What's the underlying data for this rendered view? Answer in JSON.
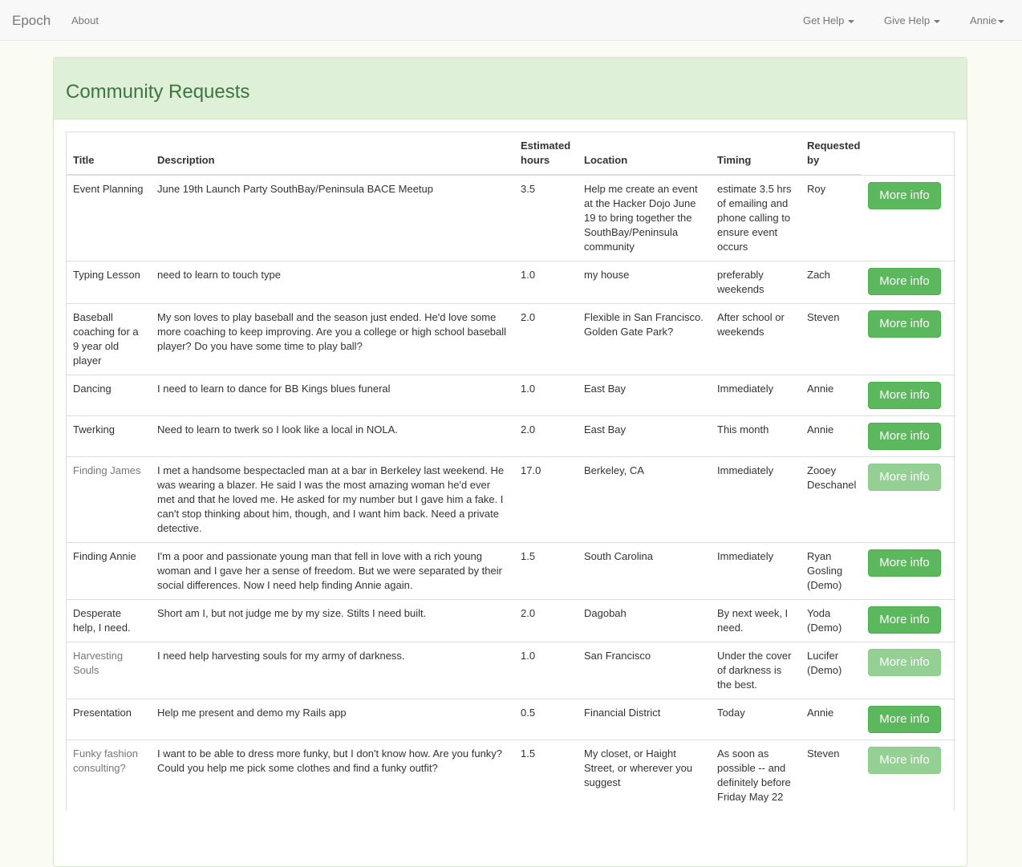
{
  "navbar": {
    "brand": "Epoch",
    "about": "About",
    "get_help": "Get Help",
    "give_help": "Give Help",
    "user": "Annie"
  },
  "panel": {
    "title": "Community Requests"
  },
  "table": {
    "headers": {
      "title": "Title",
      "description": "Description",
      "hours": "Estimated hours",
      "location": "Location",
      "timing": "Timing",
      "requested_by": "Requested by"
    },
    "rows": [
      {
        "title": "Event Planning",
        "description": "June 19th Launch Party SouthBay/Peninsula BACE Meetup",
        "hours": "3.5",
        "location": "Help me create an event at the Hacker Dojo June 19 to bring together the SouthBay/Peninsula community",
        "timing": "estimate 3.5 hrs of emailing and phone calling to ensure event occurs",
        "requested_by": "Roy",
        "button": "More info",
        "disabled": false
      },
      {
        "title": "Typing Lesson",
        "description": "need to learn to touch type",
        "hours": "1.0",
        "location": "my house",
        "timing": "preferably weekends",
        "requested_by": "Zach",
        "button": "More info",
        "disabled": false
      },
      {
        "title": "Baseball coaching for a 9 year old player",
        "description": "My son loves to play baseball and the season just ended. He'd love some more coaching to keep improving. Are you a college or high school baseball player? Do you have some time to play ball?",
        "hours": "2.0",
        "location": "Flexible in San Francisco. Golden Gate Park?",
        "timing": "After school or weekends",
        "requested_by": "Steven",
        "button": "More info",
        "disabled": false
      },
      {
        "title": "Dancing",
        "description": "I need to learn to dance for BB Kings blues funeral",
        "hours": "1.0",
        "location": "East Bay",
        "timing": "Immediately",
        "requested_by": "Annie",
        "button": "More info",
        "disabled": false
      },
      {
        "title": "Twerking",
        "description": "Need to learn to twerk so I look like a local in NOLA.",
        "hours": "2.0",
        "location": "East Bay",
        "timing": "This month",
        "requested_by": "Annie",
        "button": "More info",
        "disabled": false
      },
      {
        "title": "Finding James",
        "description": "I met a handsome bespectacled man at a bar in Berkeley last weekend. He was wearing a blazer. He said I was the most amazing woman he'd ever met and that he loved me. He asked for my number but I gave him a fake. I can't stop thinking about him, though, and I want him back. Need a private detective.",
        "hours": "17.0",
        "location": "Berkeley, CA",
        "timing": "Immediately",
        "requested_by": "Zooey Deschanel",
        "button": "More info",
        "disabled": true
      },
      {
        "title": "Finding Annie",
        "description": "I'm a poor and passionate young man that fell in love with a rich young woman and I gave her a sense of freedom. But we were separated by their social differences. Now I need help finding Annie again.",
        "hours": "1.5",
        "location": "South Carolina",
        "timing": "Immediately",
        "requested_by": "Ryan Gosling (Demo)",
        "button": "More info",
        "disabled": false
      },
      {
        "title": "Desperate help, I need.",
        "description": "Short am I, but not judge me by my size. Stilts I need built.",
        "hours": "2.0",
        "location": "Dagobah",
        "timing": "By next week, I need.",
        "requested_by": "Yoda (Demo)",
        "button": "More info",
        "disabled": false
      },
      {
        "title": "Harvesting Souls",
        "description": "I need help harvesting souls for my army of darkness.",
        "hours": "1.0",
        "location": "San Francisco",
        "timing": "Under the cover of darkness is the best.",
        "requested_by": "Lucifer (Demo)",
        "button": "More info",
        "disabled": true
      },
      {
        "title": "Presentation",
        "description": "Help me present and demo my Rails app",
        "hours": "0.5",
        "location": "Financial District",
        "timing": "Today",
        "requested_by": "Annie",
        "button": "More info",
        "disabled": false
      },
      {
        "title": "Funky fashion consulting?",
        "description": "I want to be able to dress more funky, but I don't know how. Are you funky? Could you help me pick some clothes and find a funky outfit?",
        "hours": "1.5",
        "location": "My closet, or Haight Street, or wherever you suggest",
        "timing": "As soon as possible -- and definitely before Friday May 22",
        "requested_by": "Steven",
        "button": "More info",
        "disabled": true
      }
    ]
  }
}
